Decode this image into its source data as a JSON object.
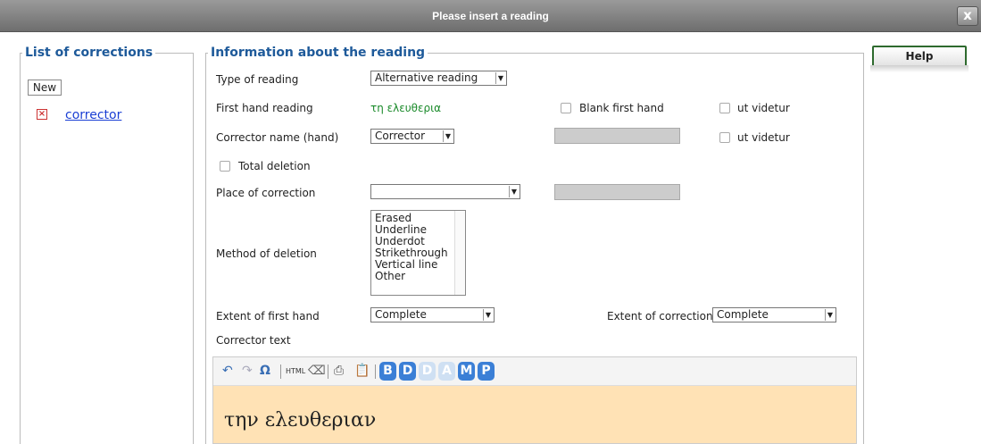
{
  "window": {
    "title": "Please insert a reading",
    "close_label": "x"
  },
  "left_panel": {
    "legend": "List of corrections",
    "new_label": "New",
    "items": [
      {
        "label": "corrector"
      }
    ]
  },
  "main": {
    "legend": "Information about the reading",
    "type_of_reading": {
      "label": "Type of reading",
      "value": "Alternative reading"
    },
    "first_hand": {
      "label": "First hand reading",
      "value": "τη ελευθερια"
    },
    "blank_first_hand": {
      "label": "Blank first hand",
      "checked": false
    },
    "ut_videtur_1": {
      "label": "ut videtur",
      "checked": false
    },
    "corrector_name": {
      "label": "Corrector name (hand)",
      "value": "Corrector"
    },
    "ut_videtur_2": {
      "label": "ut videtur",
      "checked": false
    },
    "total_deletion": {
      "label": "Total deletion",
      "checked": false
    },
    "place_of_correction": {
      "label": "Place of correction",
      "value": ""
    },
    "method_of_deletion": {
      "label": "Method of deletion",
      "options": [
        "Erased",
        "Underline",
        "Underdot",
        "Strikethrough",
        "Vertical line",
        "Other"
      ]
    },
    "extent_first_hand": {
      "label": "Extent of first hand",
      "value": "Complete"
    },
    "extent_correction": {
      "label": "Extent of correction",
      "value": "Complete"
    },
    "corrector_text": {
      "label": "Corrector text",
      "value": "την ελευθεριαν"
    },
    "toolbar": {
      "html_label": "HTML",
      "buttons": [
        "B",
        "D",
        "D",
        "A",
        "M",
        "P"
      ]
    }
  },
  "help_label": "Help",
  "colors": {
    "accent": "#1e5a9a",
    "editor_bg": "#ffe2b5",
    "green_text": "#1a8a2a"
  }
}
